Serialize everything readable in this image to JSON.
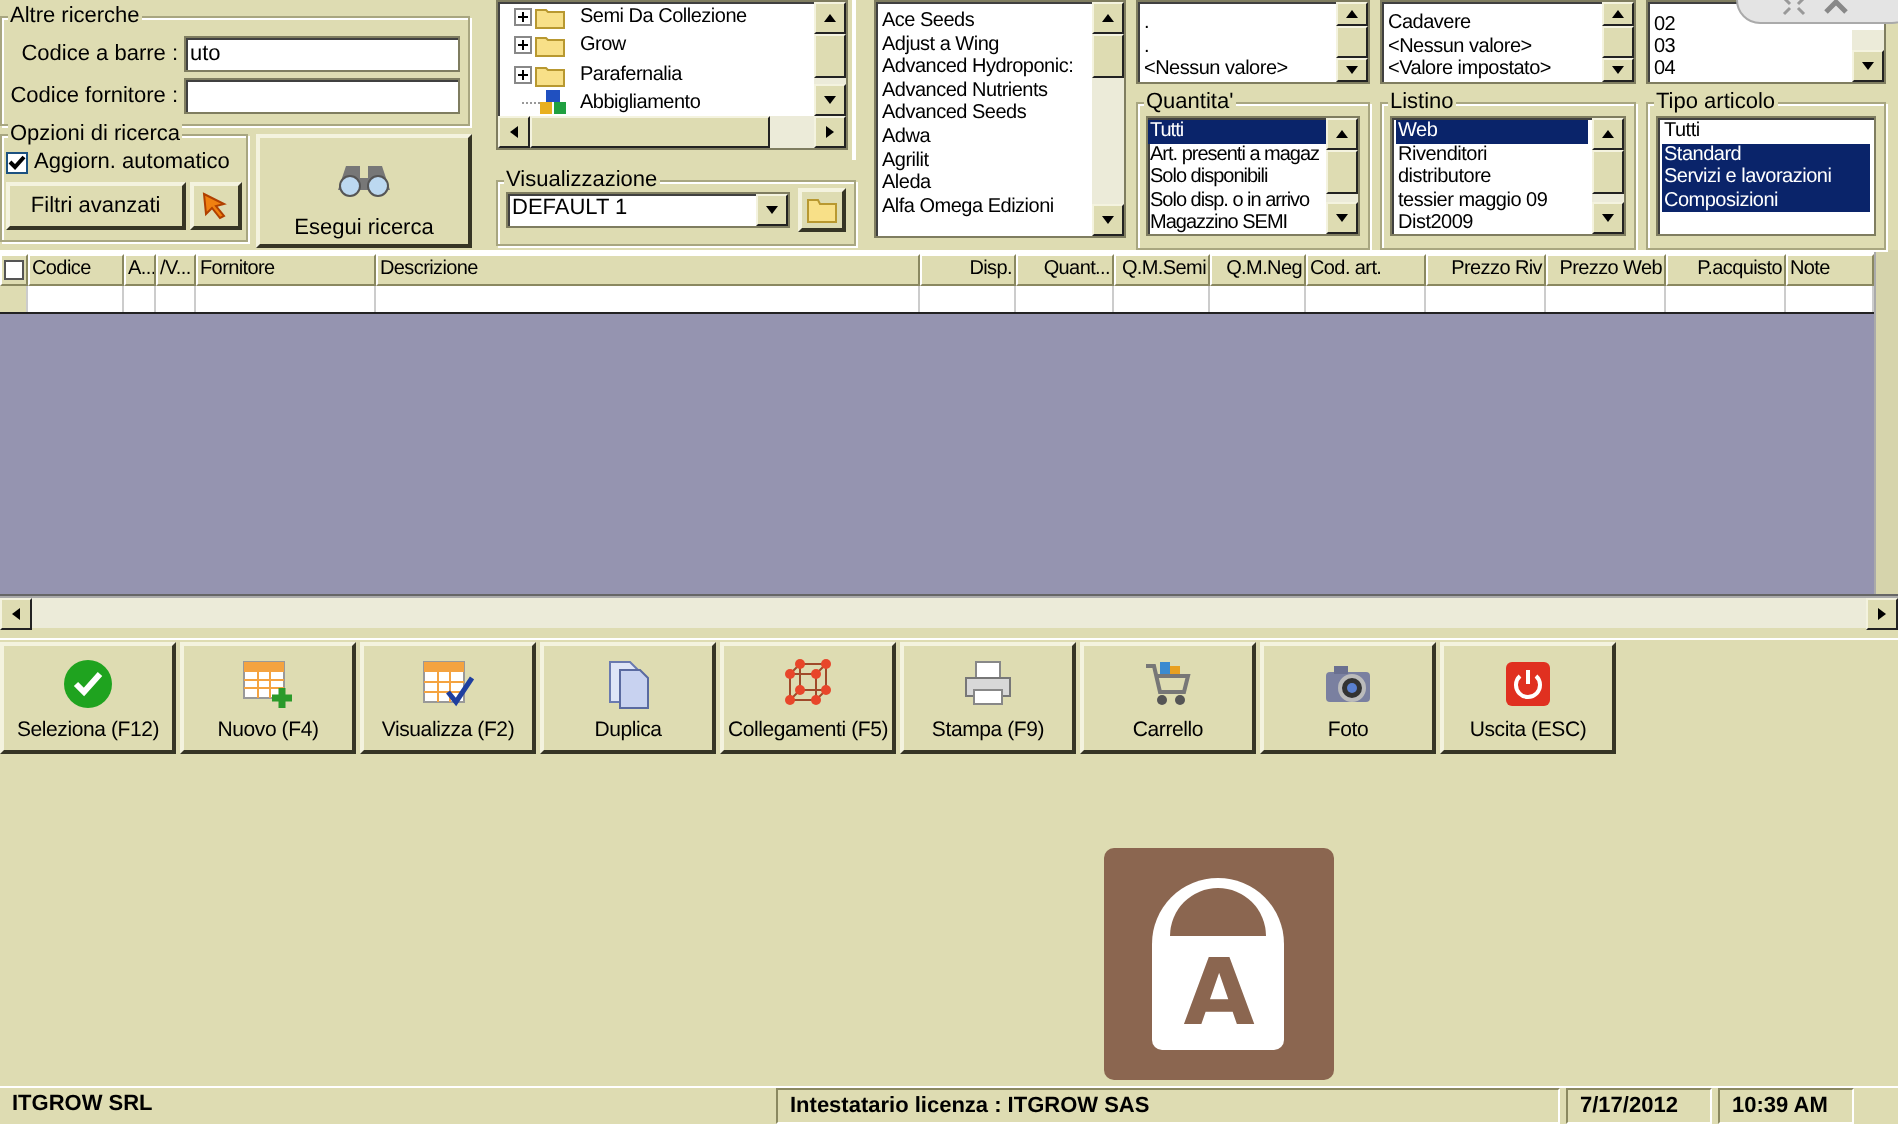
{
  "search_panel": {
    "title": "Altre ricerche",
    "fields": [
      {
        "label": "Codice a barre :",
        "value": "uto"
      },
      {
        "label": "Codice fornitore :"
      }
    ]
  },
  "search_options": {
    "title": "Opzioni di ricerca",
    "auto_update": {
      "label": "Aggiorn. automatico",
      "checked": true
    },
    "advanced_button": "Filtri avanzati"
  },
  "search_button": "Esegui ricerca",
  "category_tree": {
    "items": [
      {
        "label": "Semi Da Collezione",
        "kind": "folder"
      },
      {
        "label": "Grow",
        "kind": "folder"
      },
      {
        "label": "Parafernalia",
        "kind": "folder"
      },
      {
        "label": "Abbigliamento",
        "kind": "group"
      }
    ]
  },
  "view": {
    "title": "Visualizzazione",
    "value": "DEFAULT 1"
  },
  "brands": [
    "Ace Seeds",
    "Adjust a Wing",
    "Advanced Hydroponic:",
    "Advanced Nutrients",
    "Advanced Seeds",
    "Adwa",
    "Agrilit",
    "Aleda",
    "Alfa Omega Edizioni"
  ],
  "filter_lists": [
    {
      "items": [
        ".",
        ".",
        "<Nessun valore>"
      ]
    },
    {
      "items": [
        "Cadavere",
        "<Nessun valore>",
        "<Valore impostato>"
      ]
    },
    {
      "items": [
        "02",
        "03",
        "04"
      ]
    }
  ],
  "filter_groups": [
    {
      "title": "Quantita'",
      "items": [
        {
          "label": "Tutti",
          "selected": true
        },
        {
          "label": "Art. presenti a magaz",
          "selected": false
        },
        {
          "label": "Solo disponibili",
          "selected": false
        },
        {
          "label": "Solo disp. o in arrivo",
          "selected": false
        },
        {
          "label": "Magazzino SEMI",
          "selected": false
        }
      ]
    },
    {
      "title": "Listino",
      "items": [
        {
          "label": "Web",
          "selected": true
        },
        {
          "label": "Rivenditori",
          "selected": false
        },
        {
          "label": "distributore",
          "selected": false
        },
        {
          "label": "tessier maggio 09",
          "selected": false
        },
        {
          "label": "Dist2009",
          "selected": false
        }
      ]
    },
    {
      "title": "Tipo articolo",
      "items": [
        {
          "label": "Tutti",
          "selected": false
        },
        {
          "label": "Standard",
          "selected": true
        },
        {
          "label": "Servizi e lavorazioni",
          "selected": true
        },
        {
          "label": "Composizioni",
          "selected": true
        }
      ]
    }
  ],
  "table": {
    "select_all": {
      "checked": false
    },
    "columns": [
      "Codice",
      "A...",
      "/V...",
      "Fornitore",
      "Descrizione",
      "Disp.",
      "Quant...",
      "Q.M.Semi",
      "Q.M.Neg",
      "Cod. art.",
      "Prezzo Riv",
      "Prezzo Web",
      "P.acquisto",
      "Note"
    ]
  },
  "toolbar": [
    {
      "label": "Seleziona (F12)",
      "kind": "check"
    },
    {
      "label": "Nuovo (F4)",
      "kind": "grid-add"
    },
    {
      "label": "Visualizza (F2)",
      "kind": "grid-check"
    },
    {
      "label": "Duplica",
      "kind": "copy"
    },
    {
      "label": "Collegamenti (F5)",
      "kind": "cube"
    },
    {
      "label": "Stampa (F9)",
      "kind": "printer"
    },
    {
      "label": "Carrello",
      "kind": "cart"
    },
    {
      "label": "Foto",
      "kind": "camera"
    },
    {
      "label": "Uscita (ESC)",
      "kind": "power"
    }
  ],
  "lock_badge": {
    "letter": "A"
  },
  "status_bar": {
    "company": "ITGROW SRL",
    "license": "Intestatario licenza : ITGROW SAS",
    "date": "7/17/2012",
    "time": "10:39 AM"
  }
}
